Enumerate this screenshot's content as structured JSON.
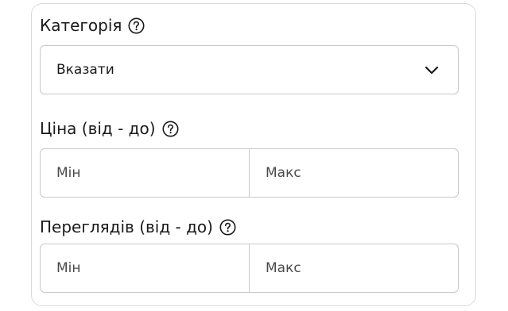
{
  "filters": {
    "category": {
      "label": "Категорія",
      "help_icon": "question-circle-icon",
      "selected_value": "Вказати",
      "dropdown_icon": "chevron-down-icon"
    },
    "price": {
      "label": "Ціна (від - до)",
      "help_icon": "question-circle-icon",
      "min_placeholder": "Мін",
      "max_placeholder": "Макс"
    },
    "views": {
      "label": "Переглядів (від - до)",
      "help_icon": "question-circle-icon",
      "min_placeholder": "Мін",
      "max_placeholder": "Макс"
    }
  },
  "colors": {
    "text": "#1a1a1a",
    "border": "#c8c8c8",
    "card_border": "#d9d9d9",
    "background": "#ffffff"
  }
}
